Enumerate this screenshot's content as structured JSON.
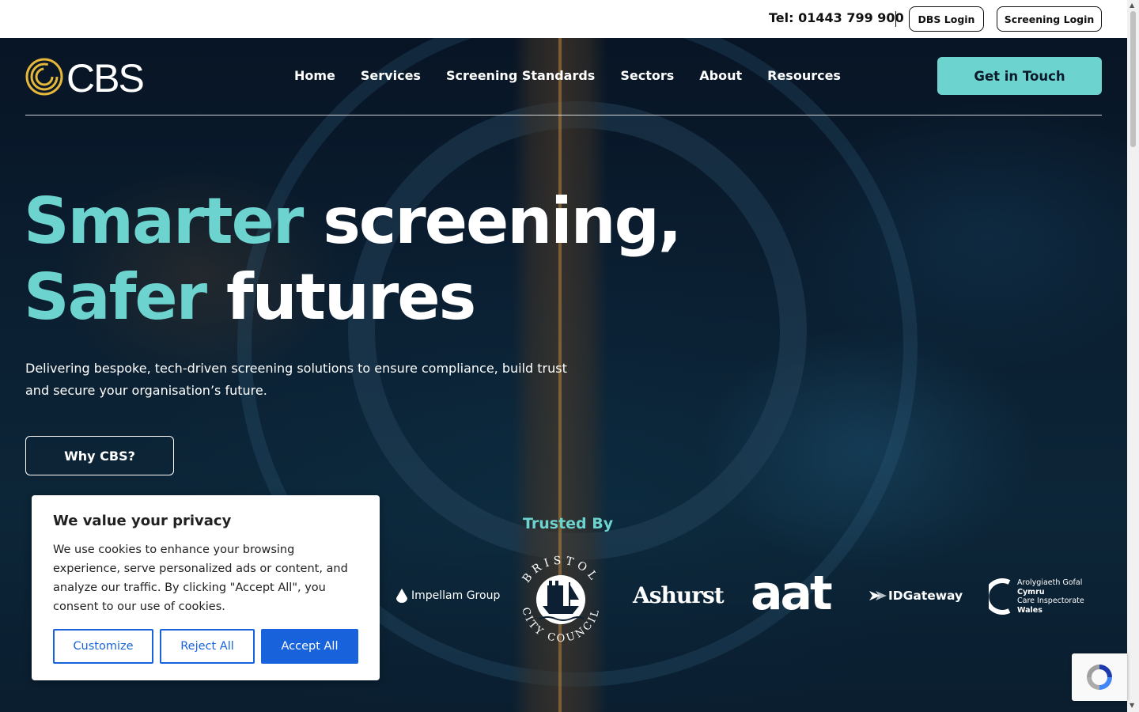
{
  "topbar": {
    "tel": "Tel: 01443 799 900",
    "dbs_login": "DBS Login",
    "screening_login": "Screening Login"
  },
  "brand": {
    "logo_text": "CBS"
  },
  "nav": {
    "items": [
      {
        "label": "Home"
      },
      {
        "label": "Services"
      },
      {
        "label": "Screening Standards"
      },
      {
        "label": "Sectors"
      },
      {
        "label": "About"
      },
      {
        "label": "Resources"
      }
    ],
    "cta": "Get in Touch"
  },
  "hero": {
    "line1_accent": "Smarter",
    "line1_rest": " screening,",
    "line2_accent": "Safer",
    "line2_rest": " futures",
    "subtext": "Delivering bespoke, tech-driven screening solutions to ensure compliance, build trust and secure your organisation’s future.",
    "button": "Why CBS?"
  },
  "trusted": {
    "title": "Trusted By",
    "logos": {
      "impellam": "Impellam Group",
      "bristol_top": "BRISTOL",
      "bristol_bottom": "CITY COUNCIL",
      "ashurst": "Ashurst",
      "aat": "aat",
      "idgateway": "IDGateway",
      "cymru_1": "Arolygiaeth Gofal",
      "cymru_2": "Cymru",
      "cymru_3": "Care Inspectorate",
      "cymru_4": "Wales"
    }
  },
  "cookie": {
    "title": "We value your privacy",
    "body": "We use cookies to enhance your browsing experience, serve personalized ads or content, and analyze our traffic. By clicking \"Accept All\", you consent to our use of cookies.",
    "customize": "Customize",
    "reject": "Reject All",
    "accept": "Accept All"
  },
  "colors": {
    "accent": "#6cd3cf",
    "cookie_blue": "#1863dc",
    "hero_dark": "#0a1a2b"
  }
}
